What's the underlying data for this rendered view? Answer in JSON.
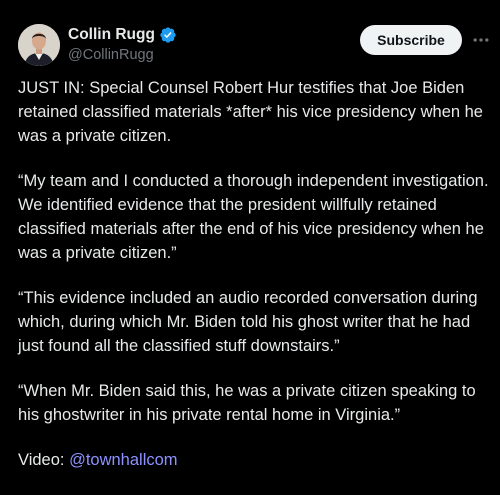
{
  "author": {
    "display_name": "Collin Rugg",
    "handle": "@CollinRugg",
    "avatar_icon": "person-avatar",
    "verified_icon": "verified-badge-icon",
    "verified_color": "#1d9bf0"
  },
  "actions": {
    "subscribe_label": "Subscribe",
    "more_icon": "more-horizontal-icon"
  },
  "tweet": {
    "paragraphs": [
      "JUST IN: Special Counsel Robert Hur testifies that Joe Biden retained classified materials *after* his vice presidency when he was a private citizen.",
      "“My team and I conducted a thorough independent investigation. We identified evidence that the president willfully retained classified materials after the end of his vice presidency when he was a private citizen.”",
      "“This evidence included an audio recorded conversation during which, during which Mr. Biden told his ghost writer that he had just found all the classified stuff downstairs.”",
      "“When Mr. Biden said this, he was a private citizen speaking to his ghostwriter in his private rental home in Virginia.”"
    ],
    "video_label": "Video: ",
    "video_link": "@townhallcom"
  },
  "colors": {
    "background": "#000000",
    "text": "#e7e9ea",
    "secondary": "#71767b",
    "link": "#8e91ff"
  }
}
